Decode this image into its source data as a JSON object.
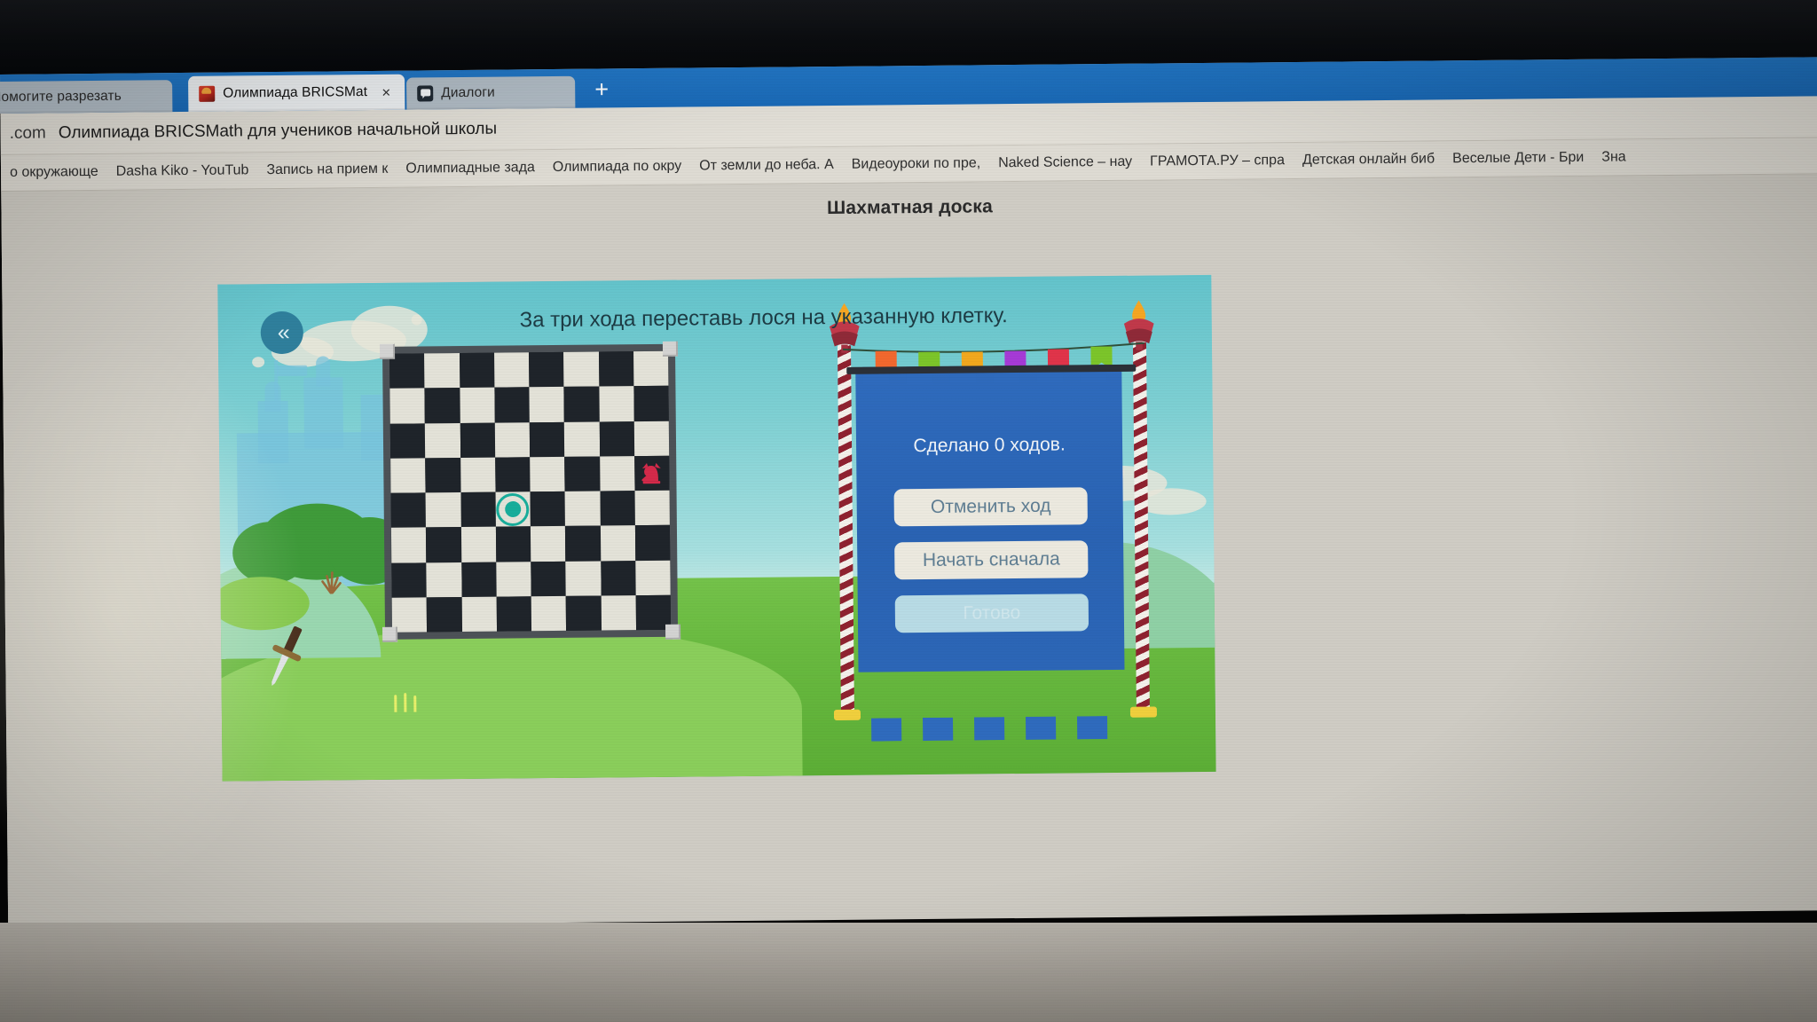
{
  "browser": {
    "tabs": [
      {
        "label": "Помогите разрезать",
        "active": false,
        "favicon": "none",
        "closable": false
      },
      {
        "label": "Олимпиада BRICSMat",
        "active": true,
        "favicon": "brics-icon",
        "closable": true,
        "close_label": "×"
      },
      {
        "label": "Диалоги",
        "active": false,
        "favicon": "dialog-icon",
        "closable": false
      }
    ],
    "new_tab_label": "+",
    "url_domain": ".com",
    "url_title": "Олимпиада BRICSMath для учеников начальной школы",
    "bookmarks": [
      "о окружающе",
      "Dasha Kiko - YouTub",
      "Запись на прием к ",
      "Олимпиадные зада",
      "Олимпиада по окру",
      "От земли до неба. А",
      "Видеоуроки по пре,",
      "Naked Science – нау",
      "ГРАМОТА.РУ – спра",
      "Детская онлайн биб",
      "Веселые Дети - Бри",
      "Зна"
    ]
  },
  "page": {
    "title": "Шахматная доска"
  },
  "game": {
    "instruction": "За три хода переставь лося на указанную клетку.",
    "back_button_glyph": "«",
    "moves_status": "Сделано 0 ходов.",
    "buttons": [
      {
        "label": "Отменить ход",
        "state": "enabled"
      },
      {
        "label": "Начать сначала",
        "state": "enabled"
      },
      {
        "label": "Готово",
        "state": "disabled"
      }
    ],
    "board": {
      "size": 8,
      "light_color": "#e3e2d8",
      "dark_color": "#1f242a",
      "frame_color": "#4d5257",
      "piece": {
        "name": "elk-knight",
        "color": "#d42a4a",
        "col": 7,
        "row": 3
      },
      "target": {
        "name": "target-marker",
        "color": "#18ad9b",
        "col": 3,
        "row": 4
      }
    },
    "decor": {
      "bunting_colors": [
        "#f2682e",
        "#7cc52a",
        "#f2a81e",
        "#a63ad6",
        "#e0344a",
        "#7cc52a"
      ],
      "lantern_color": "#b93644",
      "flame_color": "#f5a623",
      "pole_colors": [
        "#f3f0ea",
        "#8f2230"
      ],
      "banner_color": "#2f6bbd",
      "sky_color": "#7fd0d3",
      "grass_color": "#68b93f",
      "castle_color": "#79c4dd"
    }
  }
}
